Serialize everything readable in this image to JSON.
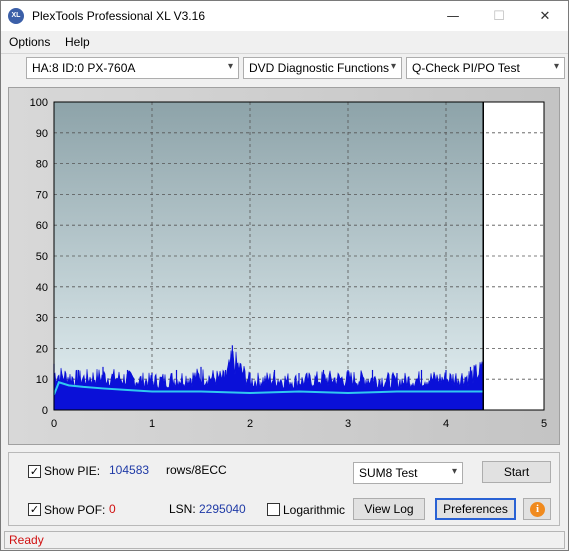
{
  "window": {
    "title": "PlexTools Professional XL V3.16",
    "icon_text": "XL",
    "minimize": "—",
    "maximize": "☐",
    "close": "✕"
  },
  "menu": {
    "options": "Options",
    "help": "Help"
  },
  "toolbar": {
    "drive": "HA:8 ID:0  PX-760A",
    "function": "DVD Diagnostic Functions",
    "test": "Q-Check PI/PO Test"
  },
  "chart_data": {
    "type": "area",
    "xlim": [
      0,
      5
    ],
    "ylim": [
      0,
      100
    ],
    "x_ticks": [
      "0",
      "1",
      "2",
      "3",
      "4",
      "5"
    ],
    "y_ticks": [
      "0",
      "10",
      "20",
      "30",
      "40",
      "50",
      "60",
      "70",
      "80",
      "90",
      "100"
    ],
    "grid": true,
    "data_end_x": 4.38,
    "series": [
      {
        "color": "#0a10d8",
        "x": [
          0.0,
          0.25,
          0.5,
          0.75,
          1.0,
          1.25,
          1.5,
          1.75,
          1.82,
          2.0,
          2.25,
          2.5,
          2.75,
          3.0,
          3.25,
          3.5,
          3.75,
          4.0,
          4.25,
          4.38
        ],
        "y": [
          15,
          13,
          14,
          13,
          12,
          13,
          14,
          13,
          21,
          12,
          13,
          12,
          13,
          13,
          13,
          12,
          13,
          13,
          14,
          17
        ]
      },
      {
        "color": "#30c8f0",
        "x": [
          0.0,
          0.05,
          0.15,
          0.3,
          0.5,
          0.75,
          1.0,
          1.5,
          2.0,
          2.5,
          3.0,
          3.5,
          4.0,
          4.38
        ],
        "y": [
          5,
          9,
          8,
          7.5,
          7,
          6.5,
          6,
          6,
          5.5,
          6,
          5.5,
          6,
          6,
          6
        ]
      }
    ],
    "colors": {
      "plot_top": "#8da3a9",
      "plot_bottom": "#e4f0f3",
      "grid": "#555555",
      "post_region": "#ffffff"
    }
  },
  "panel": {
    "show_pie_label": "Show PIE:",
    "pie_value": "104583",
    "pie_unit": "rows/8ECC",
    "show_pof_label": "Show POF:",
    "pof_value": "0",
    "lsn_label": "LSN:",
    "lsn_value": "2295040",
    "logarithmic_label": "Logarithmic",
    "sum_select": "SUM8 Test",
    "start_button": "Start",
    "view_log_button": "View Log",
    "preferences_button": "Preferences",
    "info_icon": "i",
    "check_mark": "✓"
  },
  "status": {
    "text": "Ready"
  }
}
